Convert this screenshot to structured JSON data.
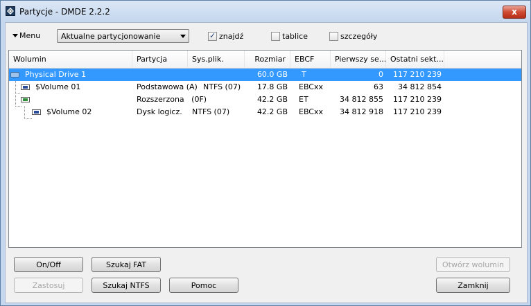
{
  "window": {
    "title": "Partycje - DMDE 2.2.2",
    "close": "x"
  },
  "toolbar": {
    "menu_label": "Menu",
    "combo_value": "Aktualne partycjonowanie",
    "checkboxes": [
      {
        "label": "znajdź",
        "checked": true
      },
      {
        "label": "tablice",
        "checked": false
      },
      {
        "label": "szczegóły",
        "checked": false
      }
    ]
  },
  "table": {
    "columns": [
      "Wolumin",
      "Partycja",
      "Sys.plik.",
      "Rozmiar",
      "EBCF",
      "Pierwszy se...",
      "Ostatni sekt..."
    ],
    "rows": [
      {
        "name": "Physical Drive 1",
        "partition": "",
        "fs": "",
        "size": "60.0 GB",
        "ebcf": "T",
        "first": "0",
        "last": "117 210 239",
        "selected": true,
        "icon": "drive-icon"
      },
      {
        "name": "$Volume 01",
        "partition": "Podstawowa (A)",
        "fs": "NTFS (07)",
        "size": "17.8 GB",
        "ebcf": "EBCxx",
        "first": "63",
        "last": "34 812 854",
        "selected": false,
        "icon": "volume-icon"
      },
      {
        "name": "",
        "partition": "Rozszerzona   (0F)",
        "fs": "",
        "size": "42.2 GB",
        "ebcf": "ET",
        "first": "34 812 855",
        "last": "117 210 239",
        "selected": false,
        "icon": "extended-partition-icon"
      },
      {
        "name": "$Volume 02",
        "partition": "Dysk logicz.",
        "fs": "NTFS (07)",
        "size": "42.2 GB",
        "ebcf": "EBCxx",
        "first": "34 812 918",
        "last": "117 210 239",
        "selected": false,
        "icon": "volume-icon"
      }
    ]
  },
  "buttons": {
    "onoff": "On/Off",
    "search_fat": "Szukaj FAT",
    "apply": "Zastosuj",
    "search_ntfs": "Szukaj NTFS",
    "help": "Pomoc",
    "open_volume": "Otwórz wolumin",
    "close": "Zamknij"
  }
}
